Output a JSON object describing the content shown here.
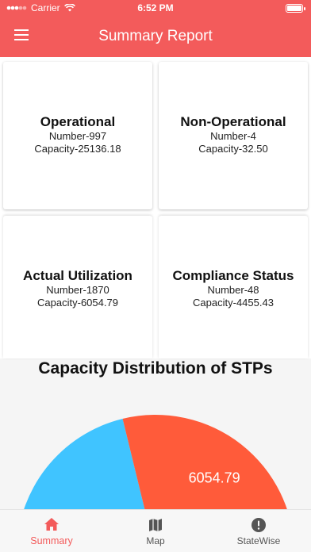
{
  "status_bar": {
    "carrier": "Carrier",
    "time": "6:52 PM"
  },
  "app_bar": {
    "title": "Summary Report"
  },
  "cards": [
    {
      "title": "Operational",
      "number": "Number-997",
      "capacity": "Capacity-25136.18"
    },
    {
      "title": "Non-Operational",
      "number": "Number-4",
      "capacity": "Capacity-32.50"
    },
    {
      "title": "Actual Utilization",
      "number": "Number-1870",
      "capacity": "Capacity-6054.79"
    },
    {
      "title": "Compliance Status",
      "number": "Number-48",
      "capacity": "Capacity-4455.43"
    }
  ],
  "distribution": {
    "title": "Capacity Distribution of STPs"
  },
  "chart_data": {
    "type": "pie",
    "categories": [
      "",
      ""
    ],
    "values": [
      4455.43,
      6054.79
    ],
    "data_labels": [
      "",
      "6054.79"
    ],
    "colors": [
      "#40c4ff",
      "#ff5b3a"
    ]
  },
  "colors": {
    "accent": "#f35b5b",
    "nav_active": "#f35b5b",
    "nav_inactive": "#555555"
  },
  "bottom_nav": {
    "items": [
      {
        "label": "Summary",
        "icon": "home-icon",
        "active": true
      },
      {
        "label": "Map",
        "icon": "map-icon",
        "active": false
      },
      {
        "label": "StateWise",
        "icon": "alert-circle-icon",
        "active": false
      }
    ]
  }
}
